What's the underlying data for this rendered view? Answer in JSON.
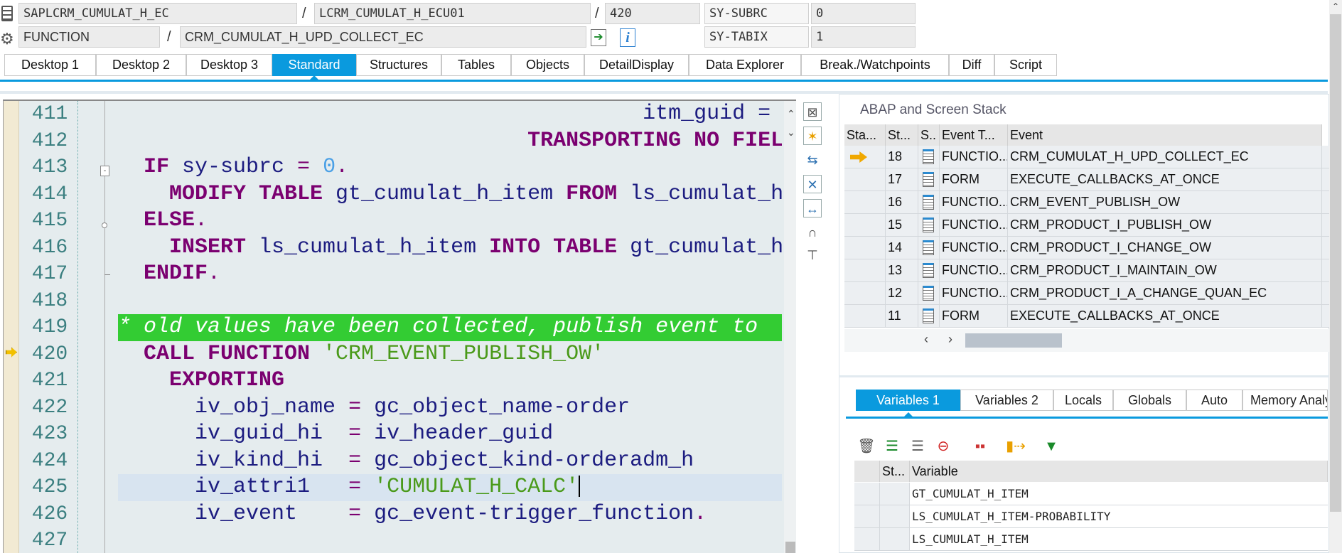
{
  "header": {
    "program": "SAPLCRM_CUMULAT_H_EC",
    "include": "LCRM_CUMULAT_H_ECU01",
    "line": "420",
    "event_type": "FUNCTION",
    "event_name": "CRM_CUMULAT_H_UPD_COLLECT_EC",
    "sy_subrc_label": "SY-SUBRC",
    "sy_subrc_value": "0",
    "sy_tabix_label": "SY-TABIX",
    "sy_tabix_value": "1",
    "separator": "/",
    "info_icon_text": "i"
  },
  "tabs": [
    "Desktop 1",
    "Desktop 2",
    "Desktop 3",
    "Standard",
    "Structures",
    "Tables",
    "Objects",
    "DetailDisplay",
    "Data Explorer",
    "Break./Watchpoints",
    "Diff",
    "Script"
  ],
  "active_tab": 3,
  "code": [
    {
      "num": "411",
      "type": "normal",
      "tokens": [
        {
          "t": "                                         itm_guid =",
          "c": "id"
        }
      ]
    },
    {
      "num": "412",
      "type": "normal",
      "tokens": [
        {
          "t": "                                TRANSPORTING NO FIELDS.",
          "c": "kw"
        }
      ]
    },
    {
      "num": "413",
      "type": "normal",
      "tokens": [
        {
          "t": "  IF",
          "c": "kw"
        },
        {
          "t": " sy-subrc ",
          "c": "id"
        },
        {
          "t": "=",
          "c": "op"
        },
        {
          "t": " 0",
          "c": "num"
        },
        {
          "t": ".",
          "c": "op"
        }
      ]
    },
    {
      "num": "414",
      "type": "normal",
      "tokens": [
        {
          "t": "    MODIFY TABLE",
          "c": "kw"
        },
        {
          "t": " gt_cumulat_h_item ",
          "c": "id"
        },
        {
          "t": "FROM",
          "c": "kw"
        },
        {
          "t": " ls_cumulat_h_item",
          "c": "id"
        }
      ]
    },
    {
      "num": "415",
      "type": "normal",
      "tokens": [
        {
          "t": "  ELSE",
          "c": "kw"
        },
        {
          "t": ".",
          "c": "op"
        }
      ]
    },
    {
      "num": "416",
      "type": "normal",
      "tokens": [
        {
          "t": "    INSERT",
          "c": "kw"
        },
        {
          "t": " ls_cumulat_h_item ",
          "c": "id"
        },
        {
          "t": "INTO TABLE",
          "c": "kw"
        },
        {
          "t": " gt_cumulat_h_item",
          "c": "id"
        }
      ]
    },
    {
      "num": "417",
      "type": "normal",
      "tokens": [
        {
          "t": "  ENDIF",
          "c": "kw"
        },
        {
          "t": ".",
          "c": "op"
        }
      ]
    },
    {
      "num": "418",
      "type": "normal",
      "tokens": []
    },
    {
      "num": "419",
      "type": "comment",
      "tokens": [
        {
          "t": "* old values have been collected, publish event to",
          "c": "cm"
        }
      ]
    },
    {
      "num": "420",
      "type": "normal",
      "tokens": [
        {
          "t": "  CALL FUNCTION",
          "c": "kw"
        },
        {
          "t": " 'CRM_EVENT_PUBLISH_OW'",
          "c": "str"
        }
      ]
    },
    {
      "num": "421",
      "type": "normal",
      "tokens": [
        {
          "t": "    EXPORTING",
          "c": "kw"
        }
      ]
    },
    {
      "num": "422",
      "type": "normal",
      "tokens": [
        {
          "t": "      iv_obj_name ",
          "c": "id"
        },
        {
          "t": "=",
          "c": "op"
        },
        {
          "t": " gc_object_name-order",
          "c": "id"
        }
      ]
    },
    {
      "num": "423",
      "type": "normal",
      "tokens": [
        {
          "t": "      iv_guid_hi  ",
          "c": "id"
        },
        {
          "t": "=",
          "c": "op"
        },
        {
          "t": " iv_header_guid",
          "c": "id"
        }
      ]
    },
    {
      "num": "424",
      "type": "normal",
      "tokens": [
        {
          "t": "      iv_kind_hi  ",
          "c": "id"
        },
        {
          "t": "=",
          "c": "op"
        },
        {
          "t": " gc_object_kind-orderadm_h",
          "c": "id"
        }
      ]
    },
    {
      "num": "425",
      "type": "current",
      "tokens": [
        {
          "t": "      iv_attri1   ",
          "c": "id"
        },
        {
          "t": "=",
          "c": "op"
        },
        {
          "t": " 'CUMULAT_H_CALC'",
          "c": "str"
        }
      ]
    },
    {
      "num": "426",
      "type": "normal",
      "tokens": [
        {
          "t": "      iv_event    ",
          "c": "id"
        },
        {
          "t": "=",
          "c": "op"
        },
        {
          "t": " gc_event-trigger_function",
          "c": "id"
        },
        {
          "t": ".",
          "c": "op"
        }
      ]
    },
    {
      "num": "427",
      "type": "normal",
      "tokens": []
    }
  ],
  "execution_line": "420",
  "stack": {
    "title": "ABAP and Screen Stack",
    "columns": [
      "Sta...",
      "St...",
      "S..",
      "Event T...",
      "Event"
    ],
    "rows": [
      {
        "level": "18",
        "type": "FUNCTIO...",
        "event": "CRM_CUMULAT_H_UPD_COLLECT_EC",
        "current": true
      },
      {
        "level": "17",
        "type": "FORM",
        "event": "EXECUTE_CALLBACKS_AT_ONCE"
      },
      {
        "level": "16",
        "type": "FUNCTIO...",
        "event": "CRM_EVENT_PUBLISH_OW"
      },
      {
        "level": "15",
        "type": "FUNCTIO...",
        "event": "CRM_PRODUCT_I_PUBLISH_OW"
      },
      {
        "level": "14",
        "type": "FUNCTIO...",
        "event": "CRM_PRODUCT_I_CHANGE_OW"
      },
      {
        "level": "13",
        "type": "FUNCTIO...",
        "event": "CRM_PRODUCT_I_MAINTAIN_OW"
      },
      {
        "level": "12",
        "type": "FUNCTIO...",
        "event": "CRM_PRODUCT_I_A_CHANGE_QUAN_EC"
      },
      {
        "level": "11",
        "type": "FORM",
        "event": "EXECUTE_CALLBACKS_AT_ONCE"
      }
    ]
  },
  "var_tabs": [
    "Variables 1",
    "Variables 2",
    "Locals",
    "Globals",
    "Auto",
    "Memory Analysis"
  ],
  "var_active_tab": 0,
  "variables": {
    "columns": [
      "St...",
      "Variable"
    ],
    "rows": [
      "GT_CUMULAT_H_ITEM",
      "LS_CUMULAT_H_ITEM-PROBABILITY",
      "LS_CUMULAT_H_ITEM"
    ]
  },
  "colors": {
    "accent": "#0a9ade",
    "comment_bg": "#33cc33",
    "keyword": "#7b0070",
    "string": "#4a9a1a"
  }
}
